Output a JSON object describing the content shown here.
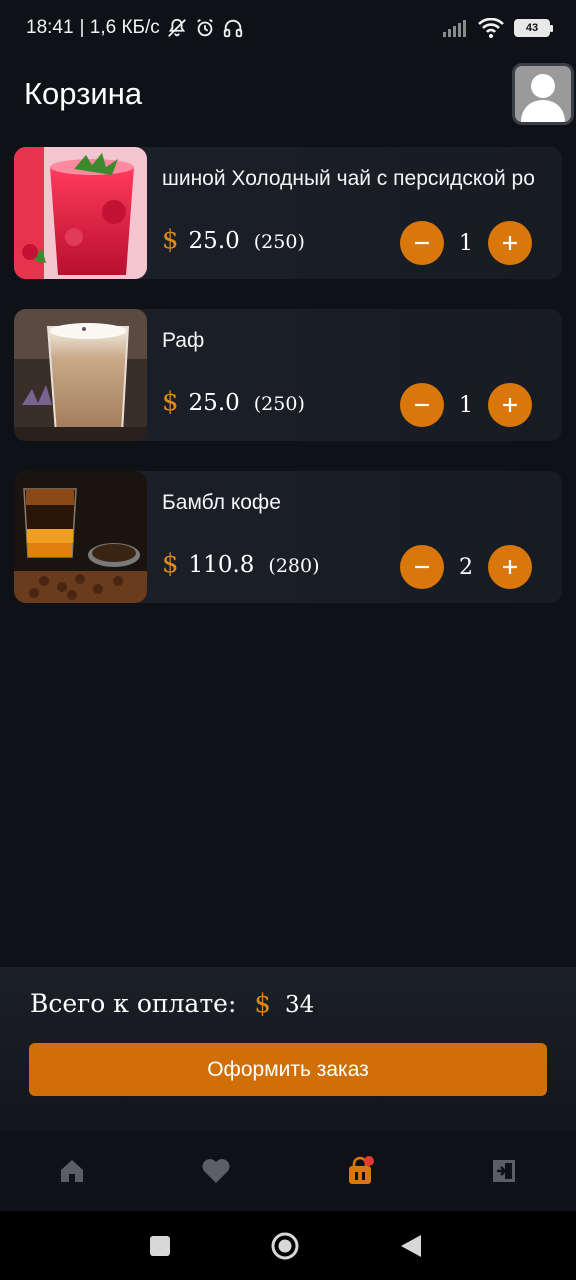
{
  "status_bar": {
    "time": "18:41",
    "network_speed": "| 1,6 КБ/с",
    "battery": "43",
    "icons": [
      "mute-icon",
      "alarm-icon",
      "headphones-icon",
      "signal-icon",
      "wifi-icon",
      "battery-icon"
    ]
  },
  "header": {
    "title": "Корзина",
    "avatar_icon": "user-avatar-icon"
  },
  "cart": {
    "currency_symbol": "$",
    "items": [
      {
        "name": "шиной Холодный чай с персидской ро",
        "price": "25.0",
        "volume": "(250)",
        "quantity": "1"
      },
      {
        "name": "Раф",
        "price": "25.0",
        "volume": "(250)",
        "quantity": "1"
      },
      {
        "name": "Бамбл кофе",
        "price": "110.8",
        "volume": "(280)",
        "quantity": "2"
      }
    ]
  },
  "checkout": {
    "total_label": "Всего к оплате:",
    "currency_symbol": "$",
    "total_value": "34",
    "order_button": "Оформить заказ"
  },
  "bottom_nav": {
    "items": [
      "home-icon",
      "favorites-icon",
      "cart-icon",
      "logout-icon"
    ],
    "active": "cart-icon",
    "active_color": "#d9770c",
    "inactive_color": "#5a5e66",
    "badge_color": "#e53935"
  },
  "colors": {
    "accent": "#d9770c",
    "background": "#0e1116",
    "card": "#1c2029"
  }
}
